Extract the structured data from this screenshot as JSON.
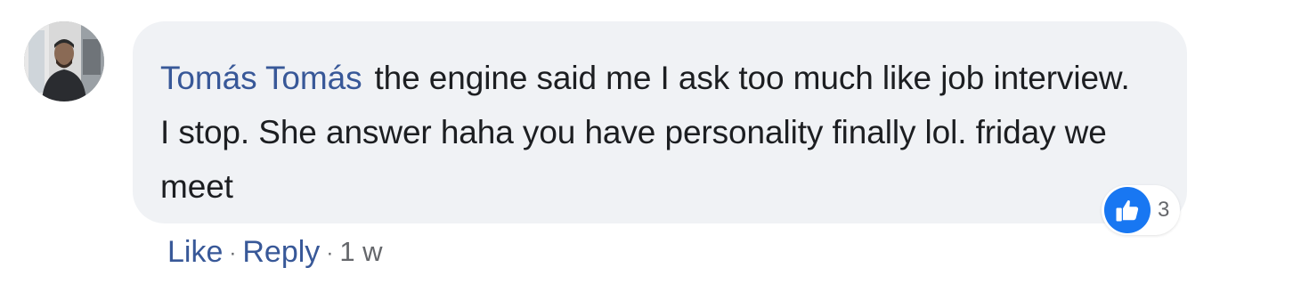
{
  "comment": {
    "author": "Tomás Tomás",
    "text": "the engine said me I ask too much like job interview. I stop. She answer haha you have personality finally lol. friday we meet",
    "reactions": {
      "icon": "thumbs-up-icon",
      "count": "3",
      "color": "#1877f2"
    },
    "actions": {
      "like_label": "Like",
      "reply_label": "Reply",
      "separator": "·",
      "timestamp": "1 w"
    }
  },
  "colors": {
    "link": "#385898",
    "bubble": "#f0f2f5",
    "text": "#1c1e21",
    "meta": "#65676b"
  }
}
